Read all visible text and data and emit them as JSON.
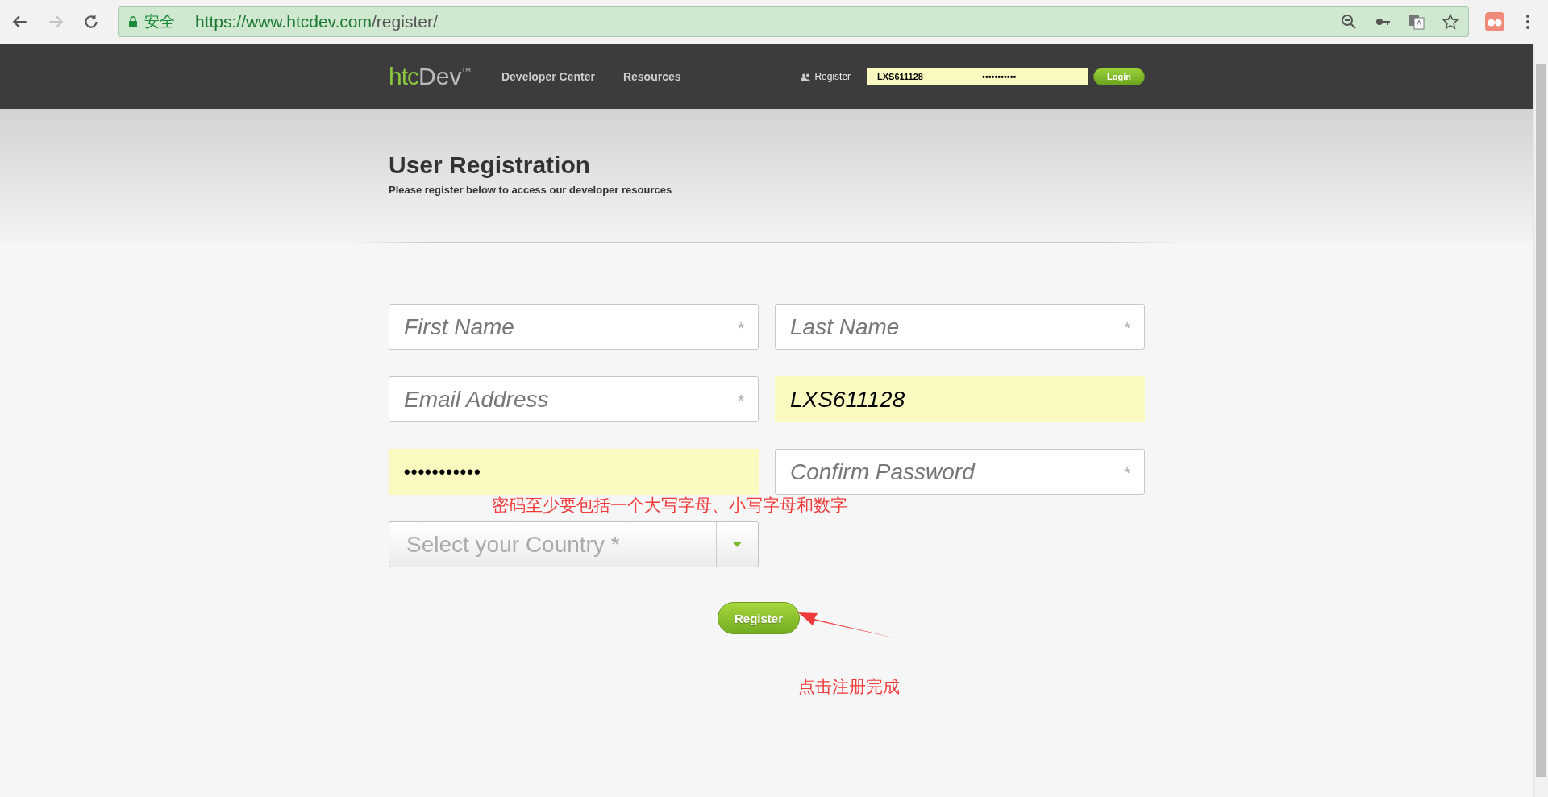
{
  "browser": {
    "security_label": "安全",
    "url_host": "https://www.htcdev.com",
    "url_path": "/register/",
    "forward_disabled": true
  },
  "header": {
    "logo_main": "htc",
    "logo_sub": "Dev",
    "logo_mark": "TM",
    "nav": [
      "Developer Center",
      "Resources"
    ],
    "register_link": "Register",
    "login_username": "LXS611128",
    "login_password": "•••••••••••",
    "login_button": "Login"
  },
  "page": {
    "title": "User Registration",
    "subtitle": "Please register below to access our developer resources"
  },
  "fields": [
    {
      "kind": "text",
      "placeholder": "First Name",
      "required_mark": "*",
      "autofilled": false
    },
    {
      "kind": "text",
      "placeholder": "Last Name",
      "required_mark": "*",
      "autofilled": false
    },
    {
      "kind": "text",
      "placeholder": "Email Address",
      "required_mark": "*",
      "autofilled": false
    },
    {
      "kind": "text",
      "value": "LXS611128",
      "autofilled": true
    },
    {
      "kind": "password",
      "value": "•••••••••••",
      "autofilled": true
    },
    {
      "kind": "text",
      "placeholder": "Confirm Password",
      "required_mark": "*",
      "autofilled": false
    },
    {
      "kind": "select",
      "placeholder": "Select your Country *"
    }
  ],
  "register_button": "Register",
  "annotations": {
    "password_note": "密码至少要包括一个大写字母、小写字母和数字",
    "register_note": "点击注册完成"
  }
}
